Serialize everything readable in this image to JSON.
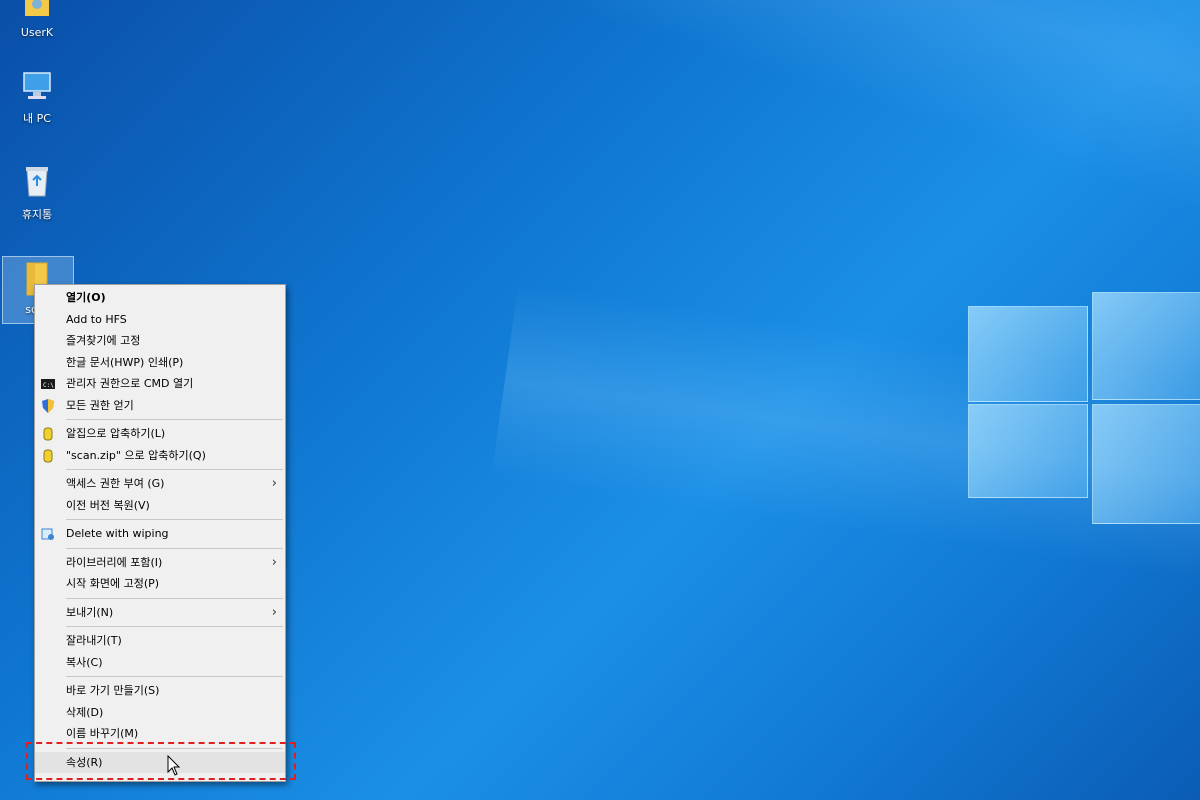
{
  "desktop_icons": [
    {
      "label": "UserK",
      "icon": "user-folder-icon"
    },
    {
      "label": "내 PC",
      "icon": "this-pc-icon"
    },
    {
      "label": "휴지통",
      "icon": "recycle-bin-icon"
    },
    {
      "label": "scan",
      "icon": "folder-icon",
      "selected": true
    }
  ],
  "context_menu": {
    "groups": [
      [
        {
          "label": "열기(O)",
          "bold": true
        },
        {
          "label": "Add to HFS"
        },
        {
          "label": "즐겨찾기에 고정"
        },
        {
          "label": "한글 문서(HWP) 인쇄(P)"
        },
        {
          "label": "관리자 권한으로 CMD 열기",
          "icon": "cmd-icon"
        },
        {
          "label": "모든 권한 얻기",
          "icon": "shield-icon"
        }
      ],
      [
        {
          "label": "알집으로 압축하기(L)",
          "icon": "alzip-icon"
        },
        {
          "label": "\"scan.zip\" 으로 압축하기(Q)",
          "icon": "alzip-icon"
        }
      ],
      [
        {
          "label": "액세스 권한 부여 (G)",
          "submenu": true
        },
        {
          "label": "이전 버전 복원(V)"
        }
      ],
      [
        {
          "label": "Delete with wiping",
          "icon": "wipe-icon"
        }
      ],
      [
        {
          "label": "라이브러리에 포함(I)",
          "submenu": true
        },
        {
          "label": "시작 화면에 고정(P)"
        }
      ],
      [
        {
          "label": "보내기(N)",
          "submenu": true
        }
      ],
      [
        {
          "label": "잘라내기(T)"
        },
        {
          "label": "복사(C)"
        }
      ],
      [
        {
          "label": "바로 가기 만들기(S)"
        },
        {
          "label": "삭제(D)"
        },
        {
          "label": "이름 바꾸기(M)"
        }
      ],
      [
        {
          "label": "속성(R)",
          "highlighted": true
        }
      ]
    ]
  },
  "colors": {
    "highlight_border": "#e02020",
    "desktop_blue": "#0f76d0",
    "menu_bg": "#f0f0f0"
  }
}
